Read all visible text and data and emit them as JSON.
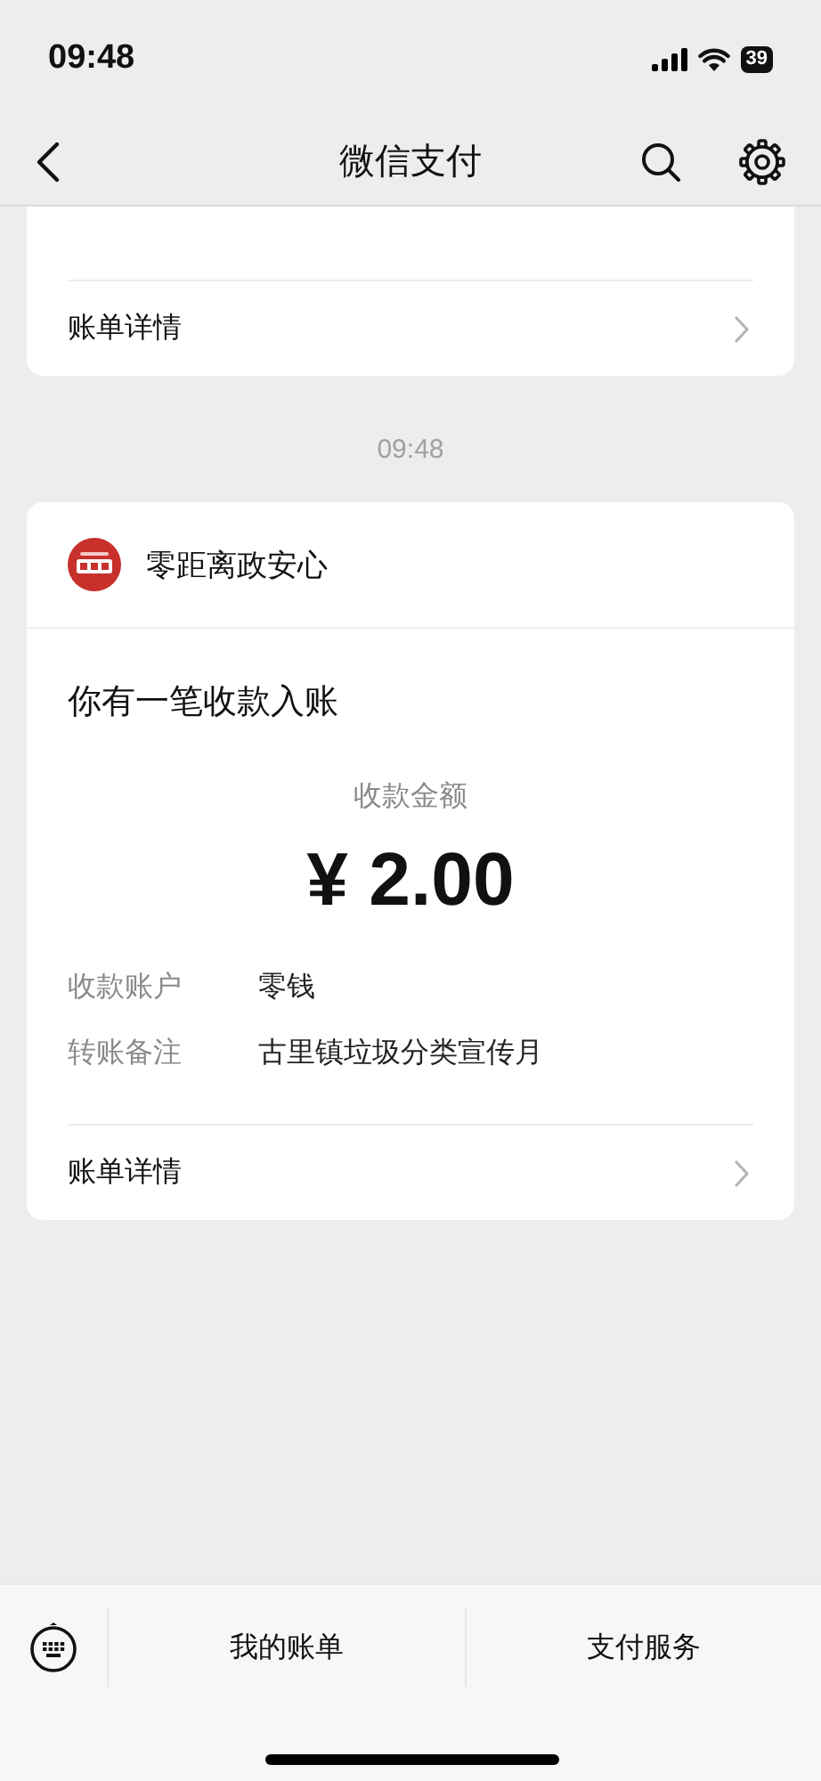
{
  "status_bar": {
    "time": "09:48",
    "battery": "39"
  },
  "nav": {
    "title": "微信支付"
  },
  "messages": [
    {
      "kind": "partial",
      "link": "账单详情"
    },
    {
      "kind": "timestamp",
      "text": "09:48"
    },
    {
      "kind": "receipt",
      "sender": "零距离政安心",
      "title": "你有一笔收款入账",
      "amount_label": "收款金额",
      "amount": "¥ 2.00",
      "fields": [
        {
          "label": "收款账户",
          "value": "零钱"
        },
        {
          "label": "转账备注",
          "value": "古里镇垃圾分类宣传月"
        }
      ],
      "link": "账单详情"
    }
  ],
  "bottom_bar": {
    "items": [
      "我的账单",
      "支付服务"
    ]
  }
}
